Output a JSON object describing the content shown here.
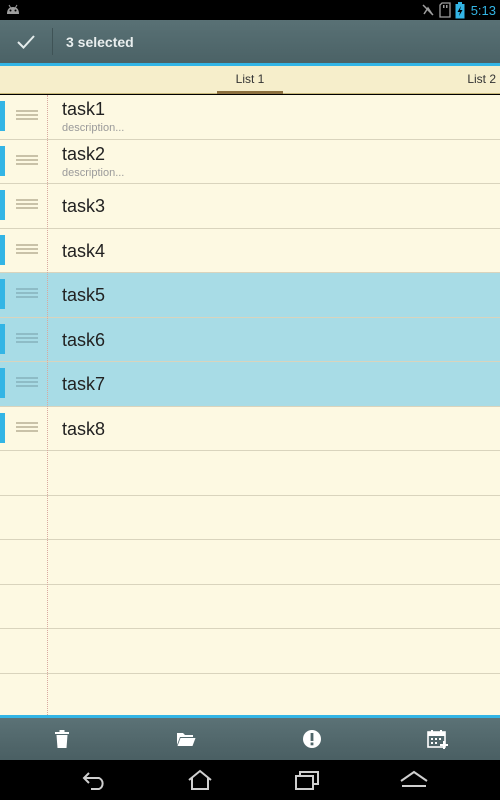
{
  "status_bar": {
    "time": "5:13",
    "icons": [
      "android-icon",
      "no-sync-icon",
      "sd-card-icon",
      "battery-charging-icon"
    ]
  },
  "action_bar": {
    "title": "3 selected",
    "done_icon": "check-icon"
  },
  "tabs": [
    {
      "label": "List 1",
      "active": true
    },
    {
      "label": "List 2",
      "active": false
    }
  ],
  "tasks": [
    {
      "title": "task1",
      "description": "description...",
      "selected": false
    },
    {
      "title": "task2",
      "description": "description...",
      "selected": false
    },
    {
      "title": "task3",
      "description": "",
      "selected": false
    },
    {
      "title": "task4",
      "description": "",
      "selected": false
    },
    {
      "title": "task5",
      "description": "",
      "selected": true
    },
    {
      "title": "task6",
      "description": "",
      "selected": true
    },
    {
      "title": "task7",
      "description": "",
      "selected": true
    },
    {
      "title": "task8",
      "description": "",
      "selected": false
    }
  ],
  "bottom_actions": [
    "delete-icon",
    "move-to-folder-icon",
    "priority-icon",
    "due-date-icon"
  ],
  "nav_bar": [
    "back-icon",
    "home-icon",
    "recent-apps-icon",
    "menu-up-icon"
  ],
  "colors": {
    "accent": "#33b5e5",
    "selection": "#a8dce6",
    "paper": "#fdf9e2",
    "action_bar": "#51686c"
  }
}
